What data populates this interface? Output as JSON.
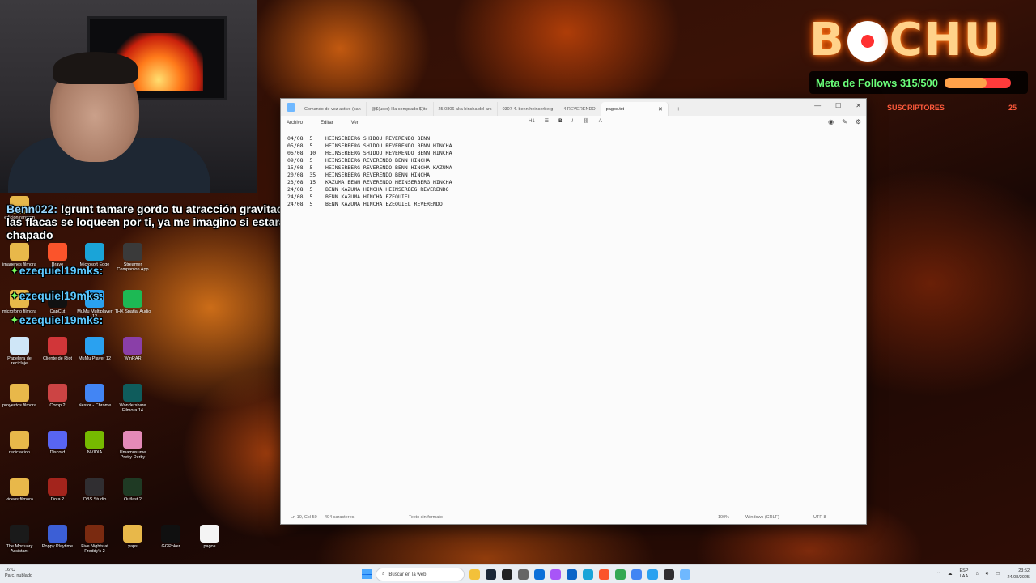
{
  "stream_overlay": {
    "logo_text": "BOCHU",
    "follows_label": "Meta de Follows 315/500",
    "follows_progress": 0.63,
    "subs_label": "SUSCRIPTORES",
    "subs_count": "25",
    "colors": {
      "accent": "#ff7a1a",
      "follows_text": "#6bff7a",
      "subs_text": "#ff5a3c"
    }
  },
  "chat": {
    "message_user": "Benn022:",
    "message_text": "!grunt tamare gordo tu atracción gravitacional hace que las flacas se loqueen por ti, ya me imagino si estarás pronto chapado",
    "follow_lines": [
      "ezequiel19mks:",
      "ezequiel19mks:",
      "ezequiel19mks:"
    ]
  },
  "desktop_icons": [
    {
      "label": "edicion random",
      "icon": "folder-icon",
      "color": "#e8b84a"
    },
    {
      "label": "imagenes filmora",
      "icon": "folder-icon",
      "color": "#e8b84a"
    },
    {
      "label": "Brave",
      "icon": "brave-icon",
      "color": "#fb542b"
    },
    {
      "label": "Microsoft Edge",
      "icon": "edge-icon",
      "color": "#1aa4d8"
    },
    {
      "label": "Streamer Companion App",
      "icon": "streamer-icon",
      "color": "#3a3a3a"
    },
    {
      "label": "microfono filmora",
      "icon": "folder-icon",
      "color": "#e8b84a"
    },
    {
      "label": "CapCut",
      "icon": "capcut-icon",
      "color": "#111111"
    },
    {
      "label": "MuMu Multiplayer 12",
      "icon": "mumu-icon",
      "color": "#2aa1f0"
    },
    {
      "label": "THX Spatial Audio",
      "icon": "thx-icon",
      "color": "#1db954"
    },
    {
      "label": "Papelera de reciclaje",
      "icon": "recycle-bin-icon",
      "color": "#cfe6f7"
    },
    {
      "label": "Cliente de Riot",
      "icon": "riot-icon",
      "color": "#d13639"
    },
    {
      "label": "MuMu Player 12",
      "icon": "mumu-icon",
      "color": "#2aa1f0"
    },
    {
      "label": "WinRAR",
      "icon": "winrar-icon",
      "color": "#8a3fa8"
    },
    {
      "label": "proyectos filmora",
      "icon": "folder-icon",
      "color": "#e8b84a"
    },
    {
      "label": "Comp 2",
      "icon": "comp-icon",
      "color": "#c44"
    },
    {
      "label": "Nestor - Chrome",
      "icon": "chrome-icon",
      "color": "#4285f4"
    },
    {
      "label": "Wondershare Filmora 14",
      "icon": "filmora-icon",
      "color": "#0f5c5c"
    },
    {
      "label": "reciclacion",
      "icon": "folder-icon",
      "color": "#e8b84a"
    },
    {
      "label": "Discord",
      "icon": "discord-icon",
      "color": "#5865f2"
    },
    {
      "label": "NVIDIA",
      "icon": "nvidia-icon",
      "color": "#76b900"
    },
    {
      "label": "Umamusume Pretty Derby",
      "icon": "umamusume-icon",
      "color": "#e48ab8"
    },
    {
      "label": "videos filmora",
      "icon": "folder-icon",
      "color": "#e8b84a"
    },
    {
      "label": "Dota 2",
      "icon": "dota-icon",
      "color": "#a3241c"
    },
    {
      "label": "OBS Studio",
      "icon": "obs-icon",
      "color": "#302e31"
    },
    {
      "label": "Outlast 2",
      "icon": "outlast-icon",
      "color": "#1f3a24"
    },
    {
      "label": "The Mortuary Assistant",
      "icon": "mortuary-icon",
      "color": "#1a1a1a"
    },
    {
      "label": "Poppy Playtime",
      "icon": "poppy-icon",
      "color": "#3c5fd6"
    },
    {
      "label": "Five Nights at Freddy's 2",
      "icon": "fnaf-icon",
      "color": "#7a2a10"
    },
    {
      "label": "yaps",
      "icon": "folder-icon",
      "color": "#e8b84a"
    },
    {
      "label": "GGPoker",
      "icon": "ggpoker-icon",
      "color": "#101010"
    },
    {
      "label": "pagos",
      "icon": "text-file-icon",
      "color": "#f4f4f4"
    }
  ],
  "notepad": {
    "tabs": [
      {
        "label": "Comando de voz activo (can",
        "active": false
      },
      {
        "label": "@$(user) Ha comprado $(ite",
        "active": false
      },
      {
        "label": "25   0806 aka hincha del ars",
        "active": false
      },
      {
        "label": "0307   4. benn heinserberg",
        "active": false
      },
      {
        "label": "4    REVERENDO",
        "active": false
      },
      {
        "label": "pagos.txt",
        "active": true
      }
    ],
    "menu": [
      "Archivo",
      "Editar",
      "Ver"
    ],
    "toolbar": {
      "heading": "H1",
      "bold": "B",
      "italic": "I"
    },
    "content_lines": [
      "04/08  5    HEINSERBERG SHIDOU REVERENDO BENN",
      "05/08  5    HEINSERBERG SHIDOU REVERENDO BENN HINCHA",
      "06/08  10   HEINSERBERG SHIDOU REVERENDO BENN HINCHA",
      "09/08  5    HEINSERBERG REVERENDO BENN HINCHA",
      "15/08  5    HEINSERBERG REVERENDO BENN HINCHA KAZUMA",
      "20/08  35   HEINSERBERG REVERENDO BENN HINCHA",
      "23/08  15   KAZUMA BENN REVERENDO HEINSERBERG HINCHA",
      "24/08  5    BENN KAZUMA HINCHA HEINSERBEG REVERENDO",
      "24/08  5    BENN KAZUMA HINCHA EZEQUIEL",
      "24/08  5    BENN KAZUMA HINCHA EZEQUIEL REVERENDO"
    ],
    "status": {
      "position": "Ln 10, Col 50",
      "chars": "494 caracteres",
      "format": "Texto sin formato",
      "zoom": "100%",
      "line_ending": "Windows (CRLF)",
      "encoding": "UTF-8"
    }
  },
  "taskbar": {
    "weather_temp": "16°C",
    "weather_desc": "Parc. nublado",
    "search_placeholder": "Buscar en la web",
    "lang_top": "ESP",
    "lang_bottom": "LAA",
    "time": "23:52",
    "date": "24/08/2025"
  }
}
